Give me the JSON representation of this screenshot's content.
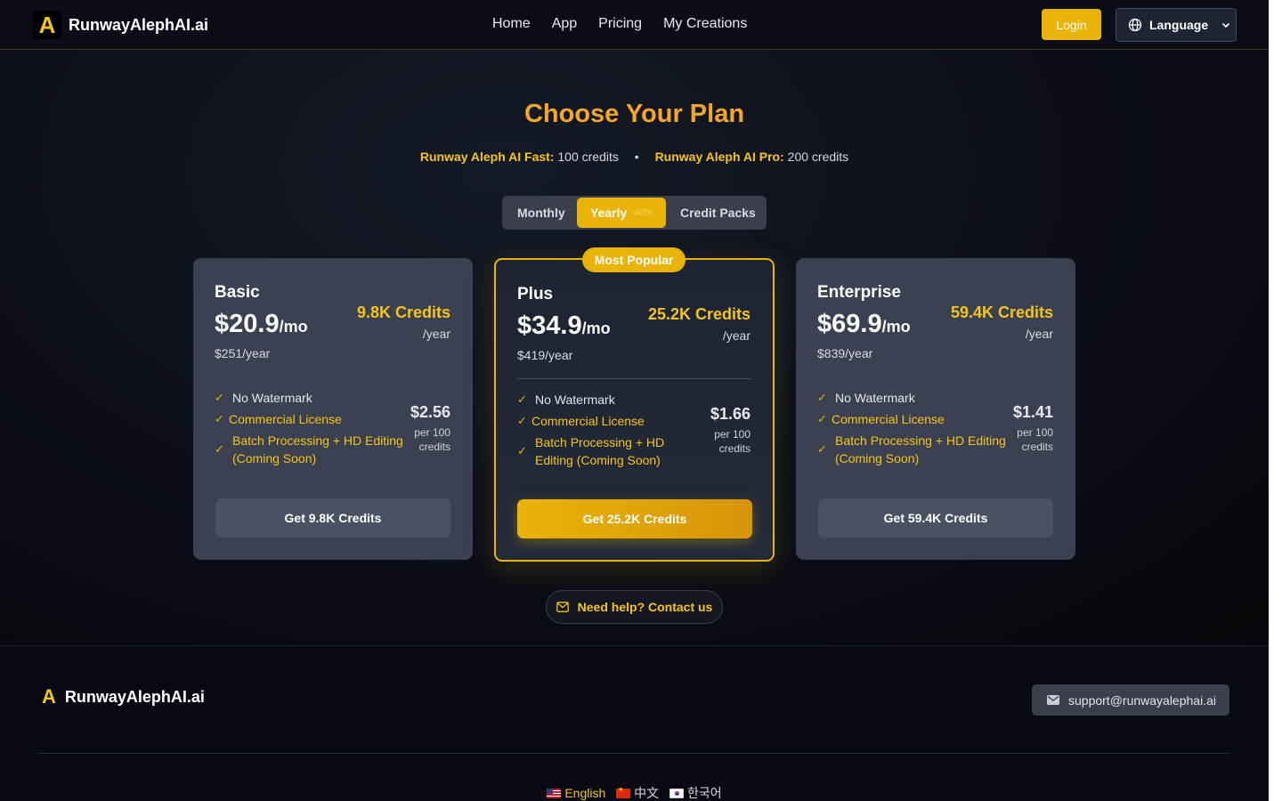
{
  "header": {
    "brand": "RunwayAlephAI.ai",
    "logo_letter": "A",
    "nav": [
      "Home",
      "App",
      "Pricing",
      "My Creations"
    ],
    "login": "Login",
    "language": "Language"
  },
  "hero": {
    "title": "Choose Your Plan",
    "fast_label": "Runway Aleph AI Fast:",
    "fast_value": "100 credits",
    "pro_label": "Runway Aleph AI Pro:",
    "pro_value": "200 credits",
    "separator": "•"
  },
  "billing_toggle": {
    "monthly": "Monthly",
    "yearly": "Yearly",
    "yearly_discount": "-40%",
    "credit_packs": "Credit Packs",
    "selected": "Yearly"
  },
  "plans": [
    {
      "name": "Basic",
      "price": "$20.9",
      "per": "/mo",
      "yearly_price": "$251/year",
      "credits": "9.8K Credits",
      "credits_unit": "/year",
      "features": [
        "No Watermark",
        "Commercial License",
        "Batch Processing + HD Editing (Coming Soon)"
      ],
      "per_credit_price": "$2.56",
      "per_credit_label": "per 100 credits",
      "cta": "Get 9.8K Credits"
    },
    {
      "name": "Plus",
      "badge": "Most Popular",
      "price": "$34.9",
      "per": "/mo",
      "yearly_price": "$419/year",
      "credits": "25.2K Credits",
      "credits_unit": "/year",
      "features": [
        "No Watermark",
        "Commercial License",
        "Batch Processing + HD Editing (Coming Soon)"
      ],
      "per_credit_price": "$1.66",
      "per_credit_label": "per 100 credits",
      "cta": "Get 25.2K Credits"
    },
    {
      "name": "Enterprise",
      "price": "$69.9",
      "per": "/mo",
      "yearly_price": "$839/year",
      "credits": "59.4K Credits",
      "credits_unit": "/year",
      "features": [
        "No Watermark",
        "Commercial License",
        "Batch Processing + HD Editing (Coming Soon)"
      ],
      "per_credit_price": "$1.41",
      "per_credit_label": "per 100 credits",
      "cta": "Get 59.4K Credits"
    }
  ],
  "help": "Need help? Contact us",
  "footer": {
    "brand": "RunwayAlephAI.ai",
    "logo_letter": "A",
    "support_email": "support@runwayalephai.ai",
    "languages": [
      "English",
      "中文",
      "한국어"
    ],
    "active_language": "English"
  },
  "colors": {
    "accent": "#eab308",
    "accent_text": "#f5c518",
    "title": "#f5a623",
    "card_bg": "#3b4150",
    "page_bg": "#0b0e17"
  }
}
